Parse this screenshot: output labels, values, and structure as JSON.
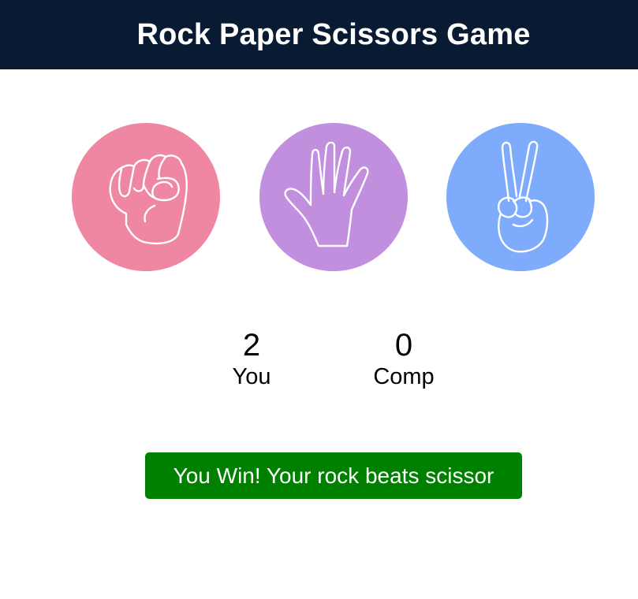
{
  "header": {
    "title": "Rock Paper Scissors Game"
  },
  "choices": [
    {
      "id": "rock",
      "icon": "rock-fist-icon",
      "color": "#f087a2"
    },
    {
      "id": "paper",
      "icon": "paper-open-hand-icon",
      "color": "#c28fdf"
    },
    {
      "id": "scissors",
      "icon": "scissors-peace-hand-icon",
      "color": "#7fabfd"
    }
  ],
  "scoreboard": {
    "user": {
      "score": "2",
      "label": "You"
    },
    "comp": {
      "score": "0",
      "label": "Comp"
    }
  },
  "message": {
    "text": "You Win! Your rock beats scissor",
    "background": "#008000",
    "text_color": "#ffffff"
  },
  "colors": {
    "header_bg": "#081b33",
    "page_bg": "#ffffff"
  }
}
